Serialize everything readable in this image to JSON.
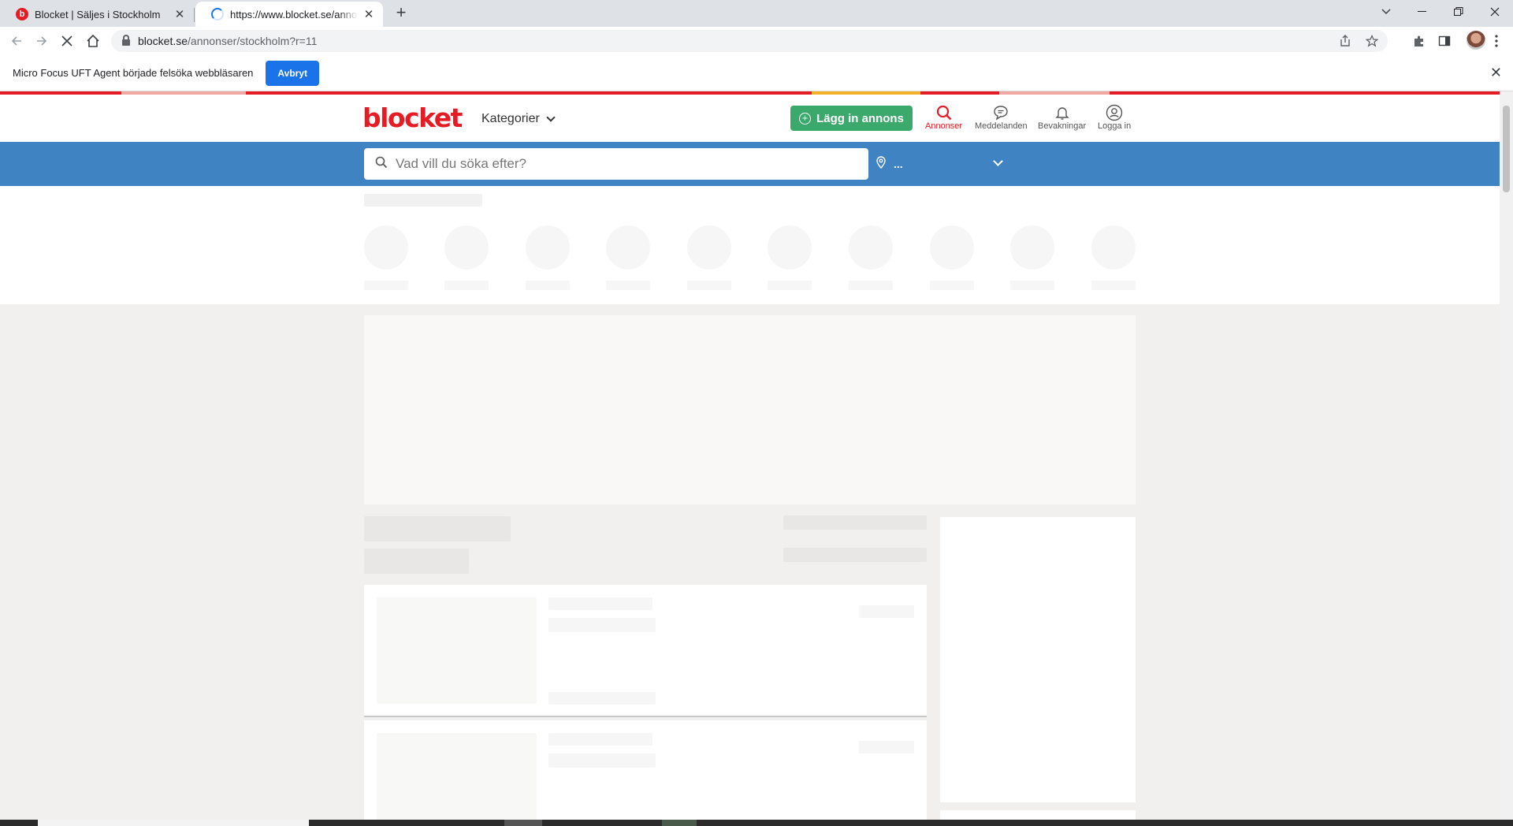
{
  "browser": {
    "tabs": [
      {
        "title": "Blocket | Säljes i Stockholm",
        "favicon_letter": "b",
        "active": false
      },
      {
        "title": "https://www.blocket.se/annonser/stockholm?r=11",
        "active": true,
        "loading": true
      }
    ],
    "new_tab_symbol": "+",
    "url_host": "blocket.se",
    "url_path": "/annonser/stockholm?r=11"
  },
  "infobar": {
    "message": "Micro Focus UFT Agent började felsöka webbläsaren",
    "cancel_label": "Avbryt"
  },
  "site": {
    "logo": "blocket",
    "categories_label": "Kategorier",
    "post_ad_label": "Lägg in annons",
    "nav": [
      {
        "label": "Annonser",
        "icon": "search-icon",
        "active": true
      },
      {
        "label": "Meddelanden",
        "icon": "message-icon",
        "active": false
      },
      {
        "label": "Bevakningar",
        "icon": "bell-icon",
        "active": false
      },
      {
        "label": "Logga in",
        "icon": "user-icon",
        "active": false
      }
    ],
    "search_placeholder": "Vad vill du söka efter?",
    "location_value": "...",
    "colors": {
      "brand_red": "#e61c24",
      "post_green": "#3aa96b",
      "search_band": "#3f83c3"
    }
  }
}
